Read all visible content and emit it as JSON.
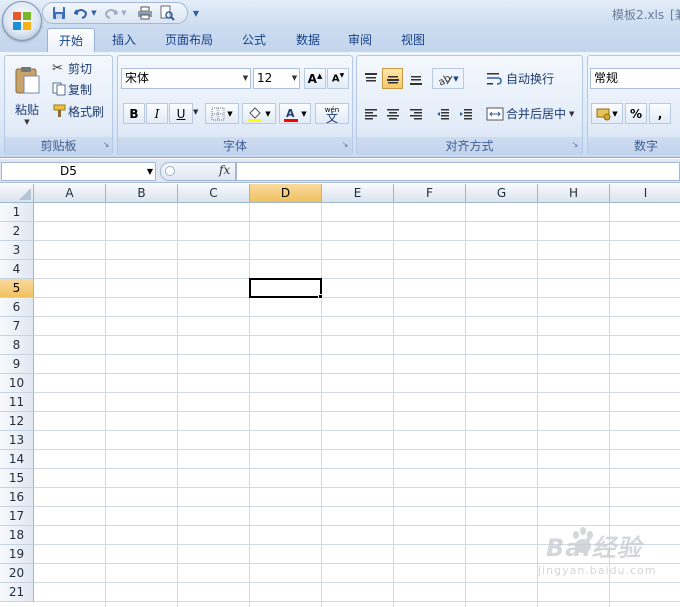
{
  "window": {
    "title": "模板2.xls",
    "title_suffix": "[兼"
  },
  "tabs": [
    "开始",
    "插入",
    "页面布局",
    "公式",
    "数据",
    "审阅",
    "视图"
  ],
  "clipboard": {
    "paste": "粘贴",
    "cut": "剪切",
    "copy": "复制",
    "format_painter": "格式刷",
    "label": "剪贴板"
  },
  "font": {
    "name": "宋体",
    "size": "12",
    "bold": "B",
    "italic": "I",
    "underline": "U",
    "phonetic": "wén",
    "phonetic_char": "文",
    "label": "字体"
  },
  "alignment": {
    "wrap_text": "自动换行",
    "merge_center": "合并后居中",
    "label": "对齐方式"
  },
  "number": {
    "format": "常规",
    "percent": "%",
    "comma": ",",
    "label": "数字"
  },
  "formula_bar": {
    "name_box": "D5",
    "fx": "fx",
    "value": ""
  },
  "sheet": {
    "columns": [
      "A",
      "B",
      "C",
      "D",
      "E",
      "F",
      "G",
      "H",
      "I"
    ],
    "rows": [
      "1",
      "2",
      "3",
      "4",
      "5",
      "6",
      "7",
      "8",
      "9",
      "10",
      "11",
      "12",
      "13",
      "14",
      "15",
      "16",
      "17",
      "18",
      "19",
      "20",
      "21"
    ],
    "active_column": "D",
    "active_row": "5"
  },
  "watermark": {
    "text": "Bai经验",
    "url": "jingyan.baidu.com"
  },
  "colors": {
    "accent": "#f1c15f",
    "ribbon": "#dfeaf8",
    "font_highlight": "#ffff00",
    "font_color": "#ff0000"
  }
}
